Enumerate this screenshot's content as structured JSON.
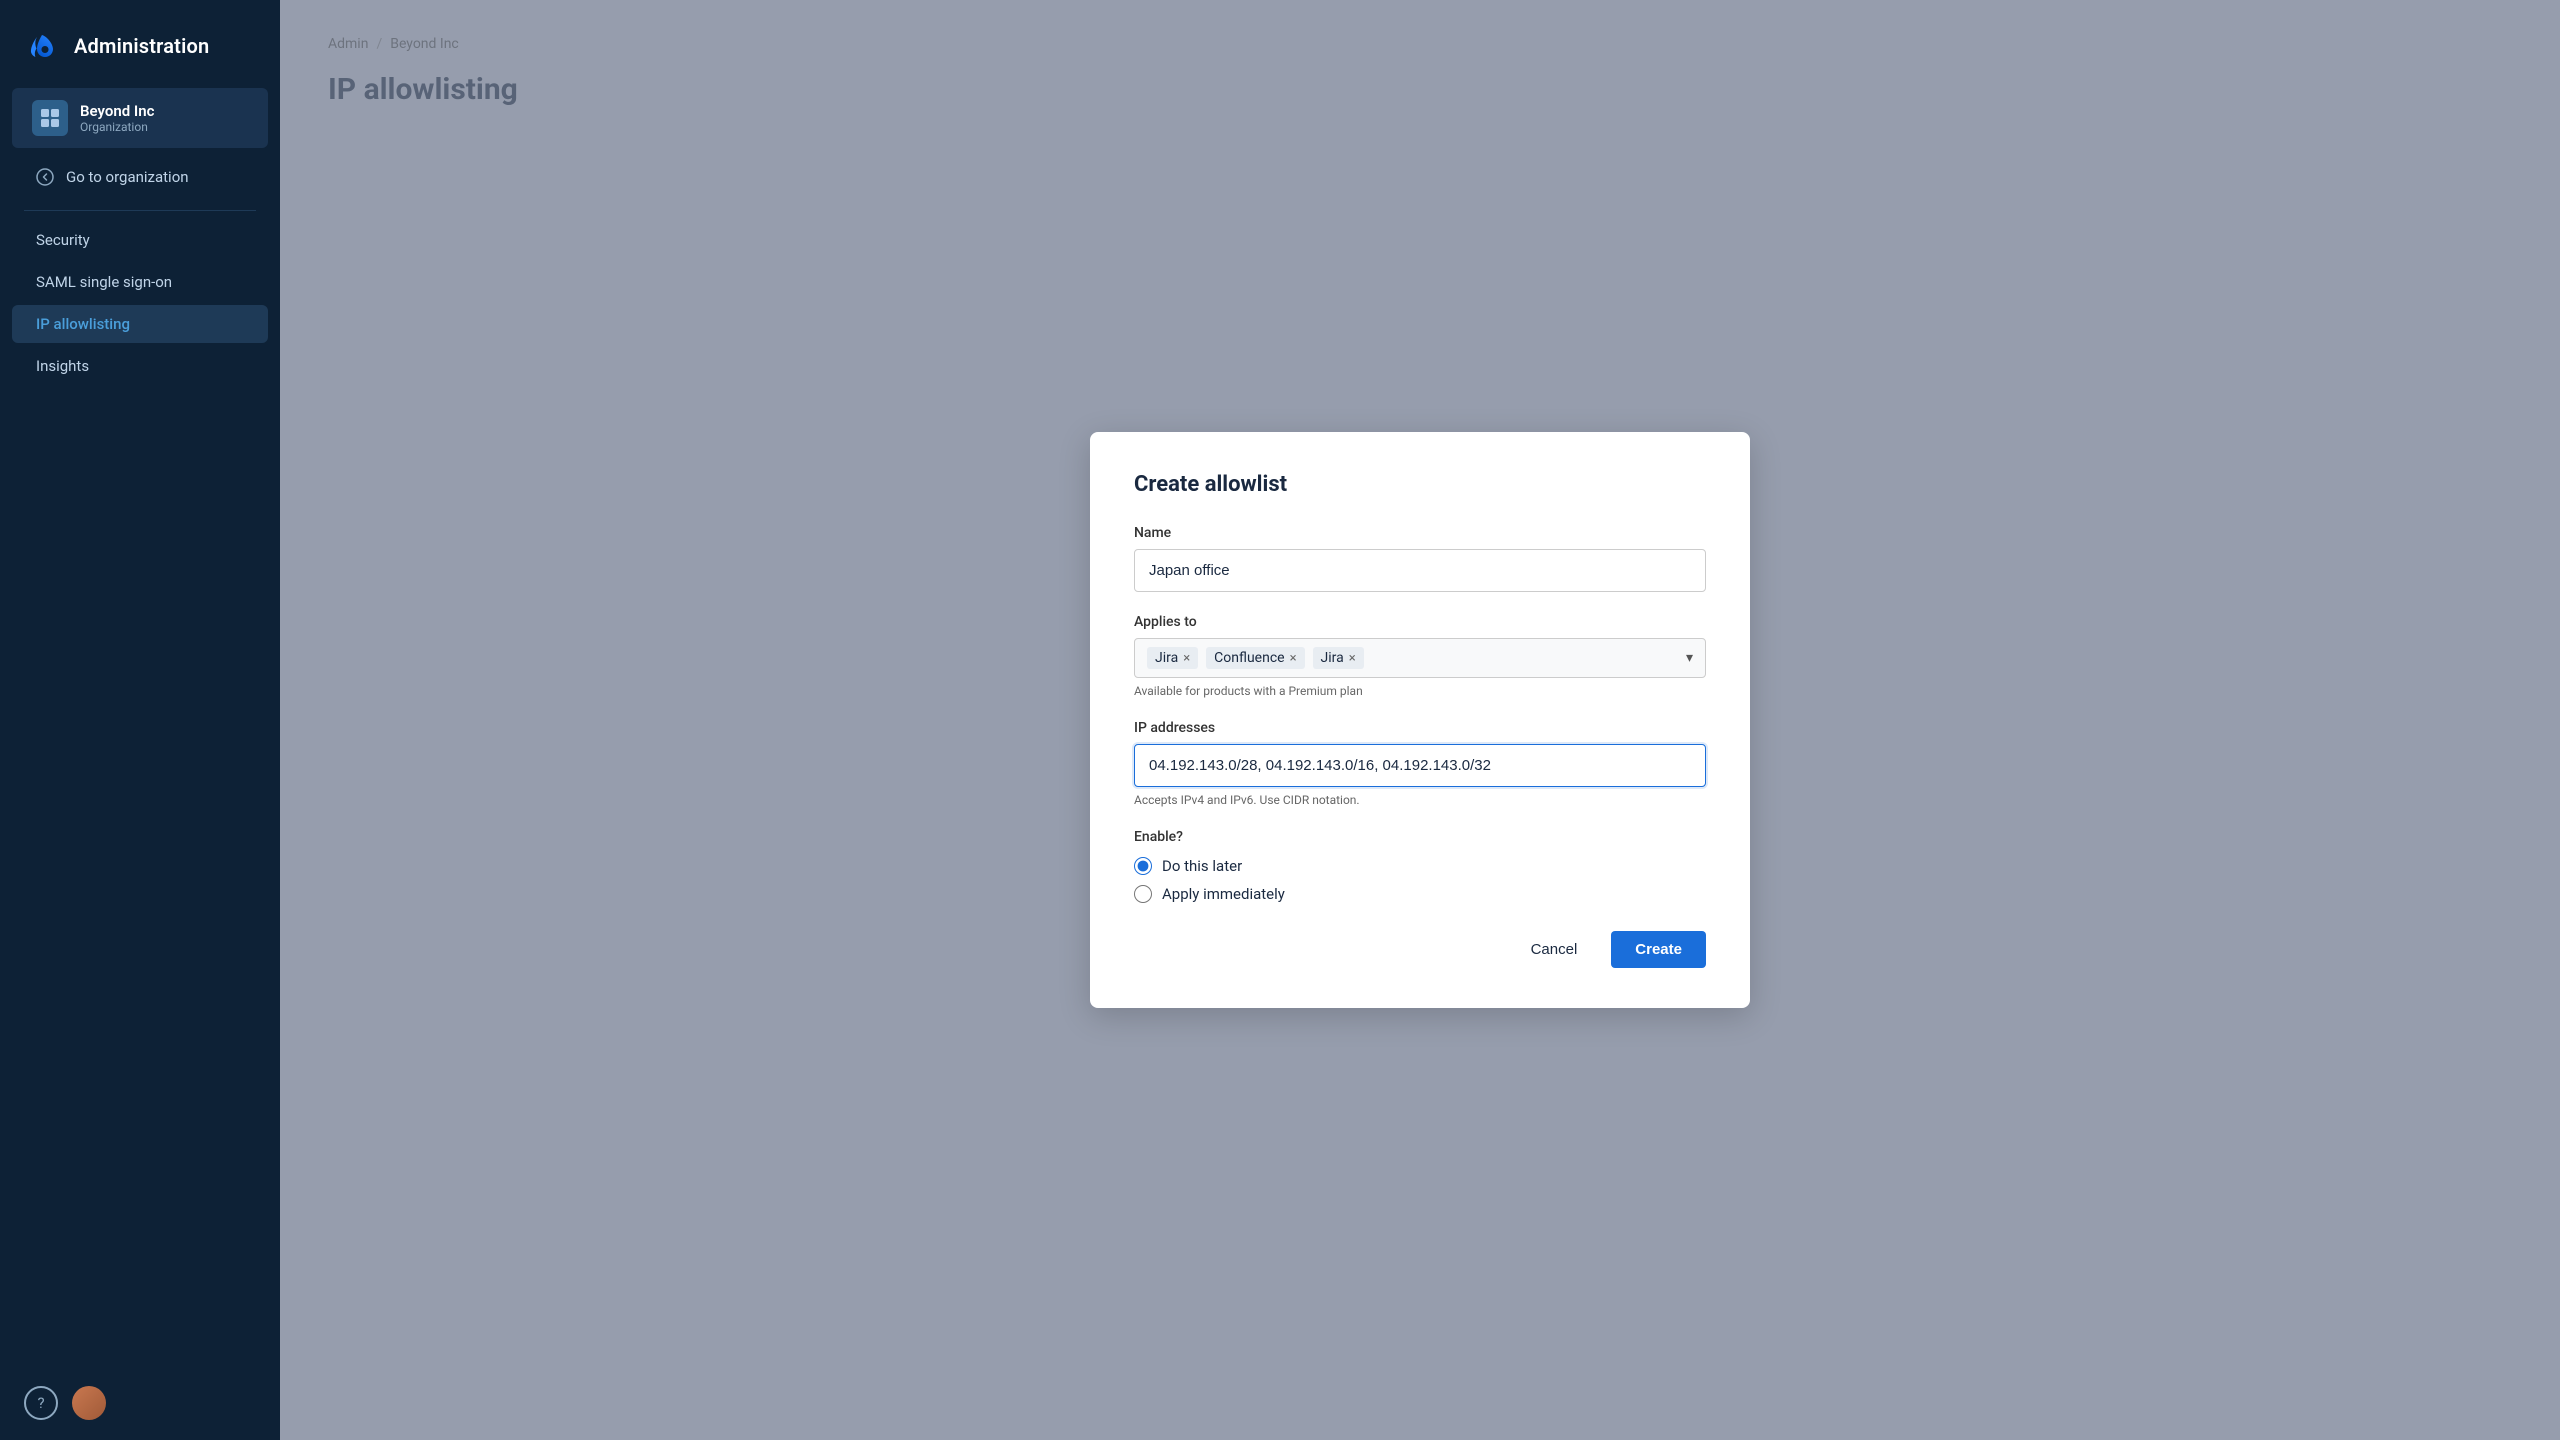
{
  "sidebar": {
    "app_name": "Administration",
    "org": {
      "name": "Beyond Inc",
      "type": "Organization"
    },
    "go_to_org_label": "Go to organization",
    "nav_items": [
      {
        "id": "security",
        "label": "Security",
        "active": false
      },
      {
        "id": "saml",
        "label": "SAML single sign-on",
        "active": false
      },
      {
        "id": "ip-allowlisting",
        "label": "IP allowlisting",
        "active": true
      },
      {
        "id": "insights",
        "label": "Insights",
        "active": false
      }
    ]
  },
  "breadcrumb": {
    "items": [
      "Admin",
      "Beyond Inc"
    ],
    "separator": "/"
  },
  "page_title": "IP allowlisting",
  "modal": {
    "title": "Create allowlist",
    "name_label": "Name",
    "name_value": "Japan office",
    "applies_to_label": "Applies to",
    "applies_to_tags": [
      "Jira",
      "Confluence",
      "Jira"
    ],
    "applies_to_hint": "Available for products with a Premium plan",
    "ip_addresses_label": "IP addresses",
    "ip_addresses_value": "04.192.143.0/28, 04.192.143.0/16, 04.192.143.0/32",
    "ip_addresses_hint": "Accepts IPv4 and IPv6. Use CIDR notation.",
    "enable_label": "Enable?",
    "radio_options": [
      {
        "id": "do-later",
        "label": "Do this later",
        "checked": true
      },
      {
        "id": "apply-immediately",
        "label": "Apply immediately",
        "checked": false
      }
    ],
    "cancel_label": "Cancel",
    "create_label": "Create"
  }
}
